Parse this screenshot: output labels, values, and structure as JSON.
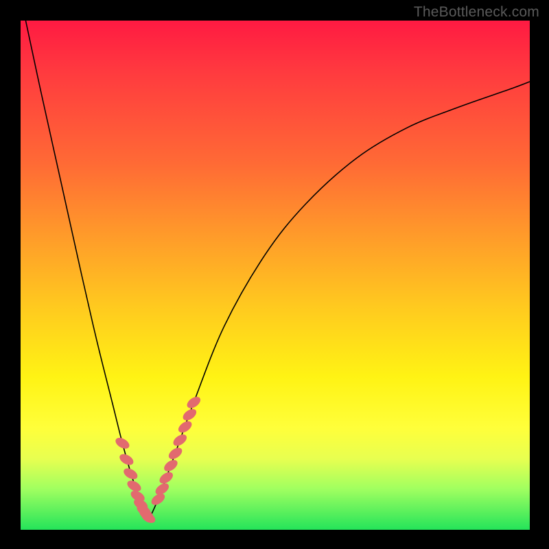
{
  "watermark": "TheBottleneck.com",
  "colors": {
    "frame": "#000000",
    "curve": "#000000",
    "bead": "#e26a6f",
    "gradient_top": "#ff1a42",
    "gradient_bottom": "#24e45a"
  },
  "chart_data": {
    "type": "line",
    "title": "",
    "xlabel": "",
    "ylabel": "",
    "xlim": [
      0,
      100
    ],
    "ylim": [
      0,
      100
    ],
    "note": "Axes are unlabeled; x and y read as percent of plot width/height. y=0 is bottom (green), y=100 is top (red). Two black curves form a V meeting near the bottom; coral bead clusters sit on both arms near the trough.",
    "series": [
      {
        "name": "left-arm",
        "x": [
          1,
          4,
          8,
          12,
          15,
          18,
          20,
          22,
          23.5,
          24.5,
          25.3
        ],
        "y": [
          100,
          86,
          68,
          50,
          37,
          25,
          17,
          10,
          6,
          3.5,
          2.2
        ]
      },
      {
        "name": "right-arm",
        "x": [
          25.3,
          27,
          30,
          34,
          40,
          48,
          56,
          66,
          76,
          86,
          96,
          100
        ],
        "y": [
          2.2,
          6,
          14,
          25,
          40,
          54,
          64,
          73,
          79,
          83,
          86.5,
          88
        ]
      }
    ],
    "beads_left": {
      "x": [
        20.0,
        20.8,
        21.6,
        22.3,
        23.0,
        23.6,
        24.2,
        24.7,
        25.1
      ],
      "y": [
        17.0,
        13.8,
        11.0,
        8.6,
        6.6,
        5.0,
        3.8,
        3.0,
        2.4
      ]
    },
    "beads_right": {
      "x": [
        27.0,
        27.8,
        28.6,
        29.5,
        30.4,
        31.3,
        32.3,
        33.2,
        34.0
      ],
      "y": [
        6.0,
        8.0,
        10.2,
        12.6,
        15.0,
        17.6,
        20.2,
        22.6,
        25.0
      ]
    }
  }
}
